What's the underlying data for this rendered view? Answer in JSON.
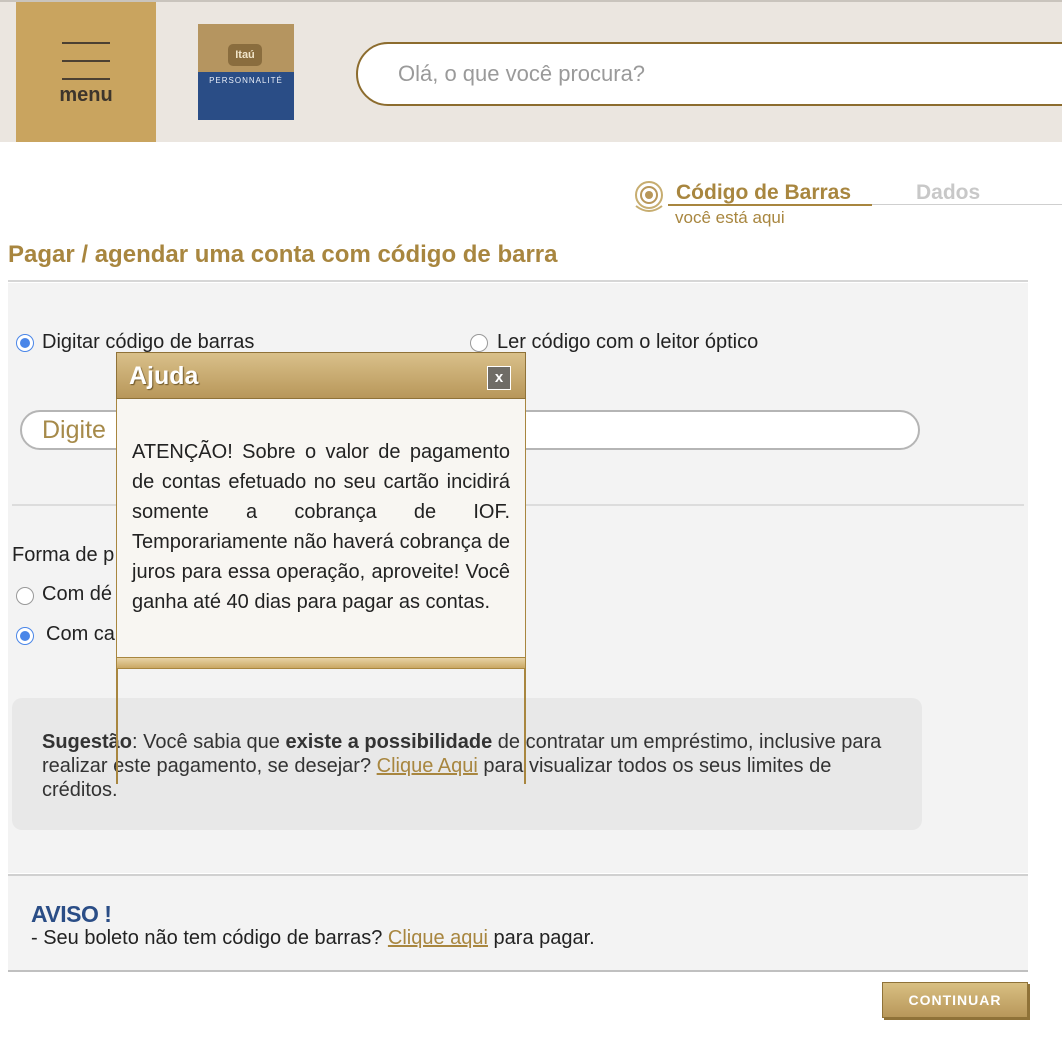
{
  "header": {
    "menu_label": "menu",
    "logo_top": "Itaú",
    "logo_bottom": "PERSONNALITÉ",
    "search_placeholder": "Olá, o que você procura?"
  },
  "steps": {
    "current_label": "Código de Barras",
    "current_sub": "você está aqui",
    "next_label": "Dados"
  },
  "page_title": "Pagar / agendar uma conta com código de barra",
  "barcode_options": {
    "type_label": "Digitar código de barras",
    "scan_label": "Ler código com o leitor óptico",
    "input_placeholder": "Digite"
  },
  "payment": {
    "label": "Forma de p",
    "option_debit": "Com dé",
    "option_card": "Com ca"
  },
  "suggestion": {
    "prefix_bold": "Sugestão",
    "text1": ": Você sabia que ",
    "bold": "existe a possibilidade",
    "text2": " de contratar um empréstimo, inclusive para realizar este pagamento, se desejar? ",
    "link": "Clique Aqui",
    "text3": " para visualizar todos os seus limites de créditos."
  },
  "aviso": {
    "title": "AVISO !",
    "text": "- Seu boleto não tem código de barras? ",
    "link": "Clique aqui",
    "text_end": " para pagar."
  },
  "continue_label": "CONTINUAR",
  "modal": {
    "title": "Ajuda",
    "close_label": "x",
    "text": "ATENÇÃO! Sobre o valor de pagamento de contas efetuado no seu cartão incidirá somente a cobrança de IOF. Temporariamente não haverá cobrança de juros para essa operação, aproveite! Você ganha até 40 dias para pagar as contas."
  },
  "colors": {
    "gold": "#a8863f",
    "menu_bg": "#c9a45f",
    "header_bg": "#ebe6e0",
    "radio_selected": "#4a86e8"
  }
}
